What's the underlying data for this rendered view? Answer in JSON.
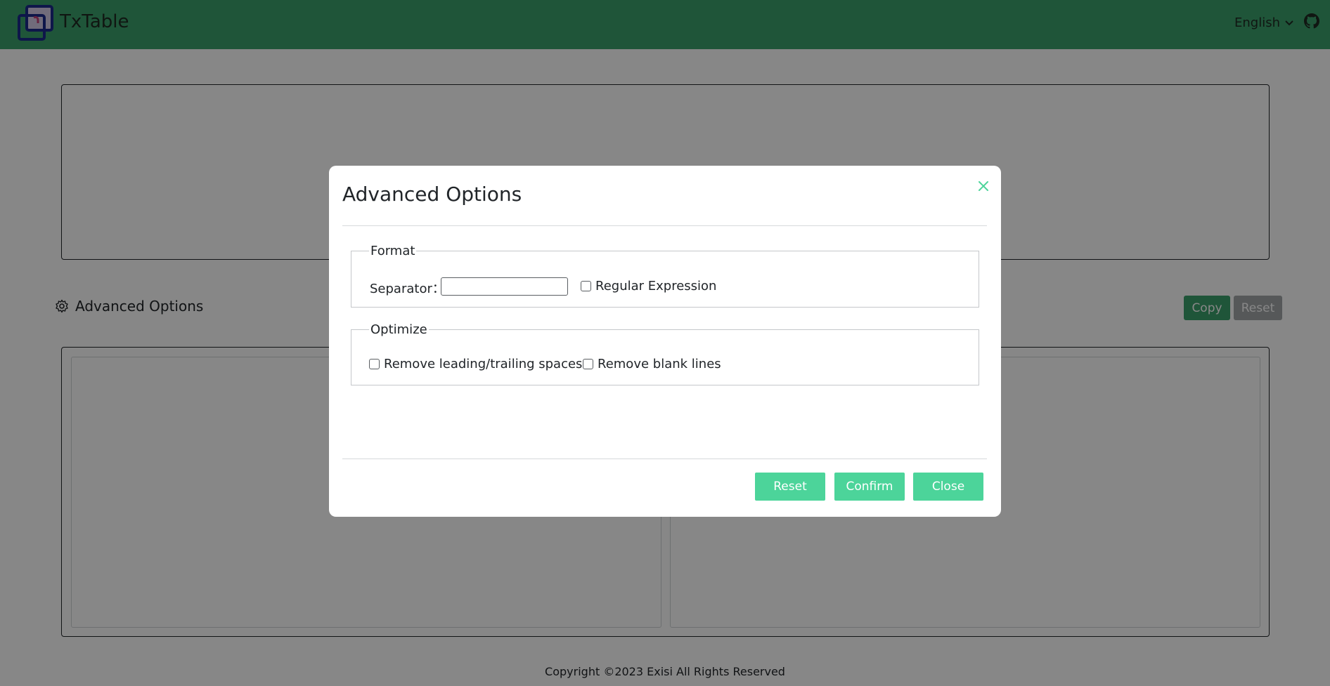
{
  "header": {
    "brand": "TxTable",
    "language": "English",
    "icons": {
      "logo": "txtable-logo-icon",
      "caret": "chevron-down-icon",
      "repo": "github-icon"
    }
  },
  "page": {
    "advanced_options_label": "Advanced Options",
    "copy_label": "Copy",
    "reset_label": "Reset",
    "footer": "Copyright ©2023 Exisi All Rights Reserved"
  },
  "modal": {
    "title": "Advanced Options",
    "format": {
      "legend": "Format",
      "separator_label": "Separator：",
      "separator_value": "",
      "regex_label": "Regular Expression",
      "regex_checked": false
    },
    "optimize": {
      "legend": "Optimize",
      "trim_label": "Remove leading/trailing spaces",
      "trim_checked": false,
      "blank_label": "Remove blank lines",
      "blank_checked": false
    },
    "buttons": {
      "reset": "Reset",
      "confirm": "Confirm",
      "close": "Close"
    }
  },
  "colors": {
    "header": "#3ca06c",
    "modal_button": "#4cd49a",
    "close_icon": "#4cd49a",
    "backdrop": "rgba(0,0,0,0.47)"
  }
}
